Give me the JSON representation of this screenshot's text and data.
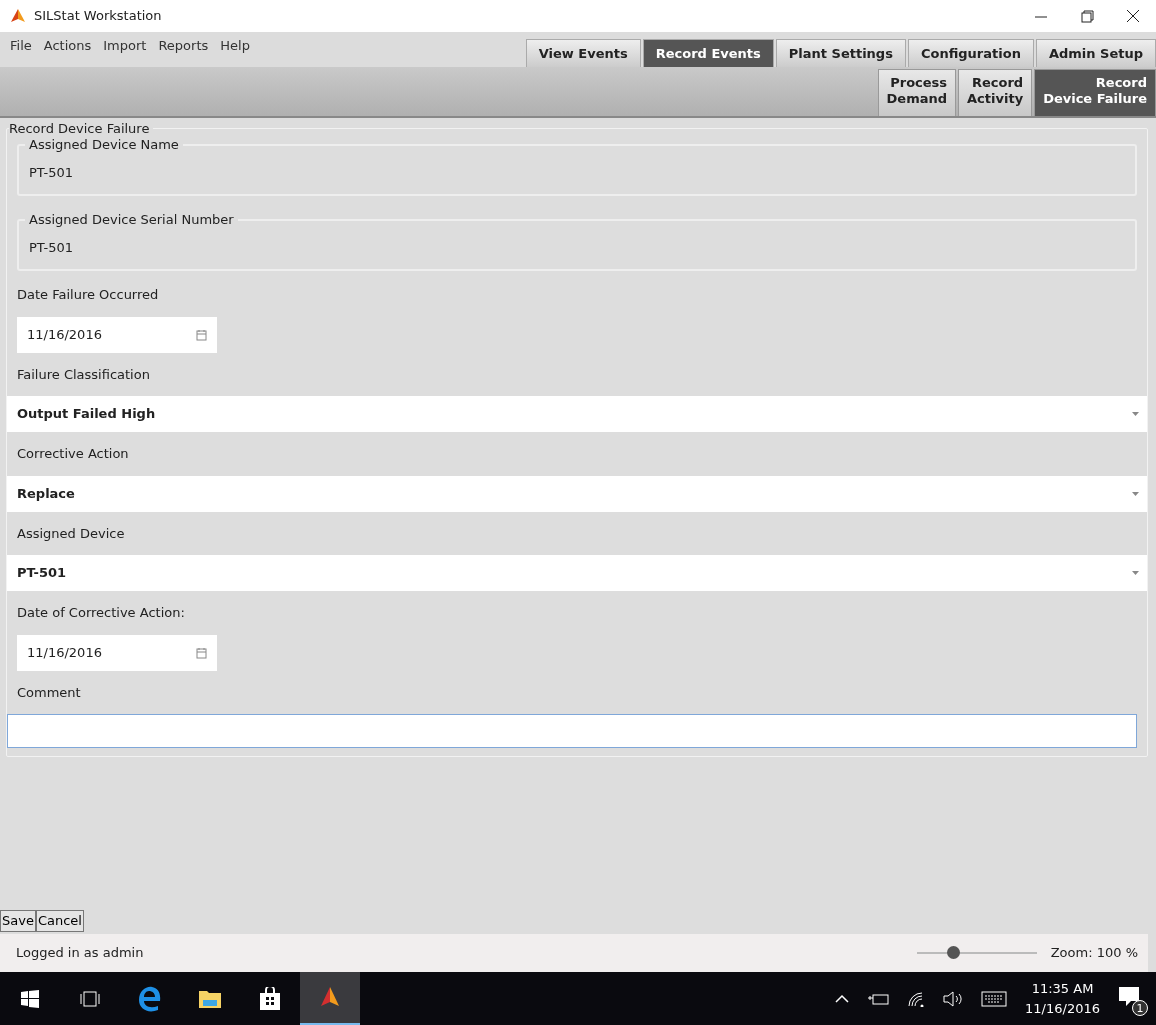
{
  "window": {
    "title": "SILStat Workstation"
  },
  "menu": [
    "File",
    "Actions",
    "Import",
    "Reports",
    "Help"
  ],
  "tabs": [
    {
      "label": "View Events",
      "selected": false
    },
    {
      "label": "Record Events",
      "selected": true
    },
    {
      "label": "Plant Settings",
      "selected": false
    },
    {
      "label": "Configuration",
      "selected": false
    },
    {
      "label": "Admin Setup",
      "selected": false
    }
  ],
  "subtabs": [
    {
      "label": "Process\nDemand",
      "selected": false
    },
    {
      "label": "Record\nActivity",
      "selected": false
    },
    {
      "label": "Record\nDevice Failure",
      "selected": true
    }
  ],
  "form": {
    "legend": "Record Device Failure",
    "fields": [
      {
        "kind": "group",
        "label": "Assigned Device Name",
        "value": "PT-501"
      },
      {
        "kind": "group",
        "label": "Assigned Device Serial Number",
        "value": "PT-501"
      },
      {
        "kind": "date",
        "label": "Date Failure Occurred",
        "value": "11/16/2016"
      },
      {
        "kind": "select",
        "label": "Failure Classification",
        "value": "Output Failed High"
      },
      {
        "kind": "select",
        "label": "Corrective Action",
        "value": "Replace"
      },
      {
        "kind": "select",
        "label": "Assigned Device",
        "value": "PT-501"
      },
      {
        "kind": "date",
        "label": "Date of Corrective Action:",
        "value": "11/16/2016"
      },
      {
        "kind": "text",
        "label": "Comment",
        "focused": true
      }
    ]
  },
  "buttons": [
    "Save",
    "Cancel"
  ],
  "status_bar": {
    "text": "Logged in as admin",
    "zoom": {
      "level": 0.3,
      "reading": "Zoom: 100 %"
    }
  },
  "taskbar": {
    "apps": [
      {
        "kind": "start",
        "selected": false
      },
      {
        "kind": "task-view",
        "selected": false
      },
      {
        "kind": "browser",
        "selected": false
      },
      {
        "kind": "folder",
        "selected": false
      },
      {
        "kind": "store",
        "selected": false
      },
      {
        "kind": "app",
        "selected": true
      }
    ],
    "time": "11:35 AM",
    "date": "11/16/2016",
    "notifications": "1"
  }
}
